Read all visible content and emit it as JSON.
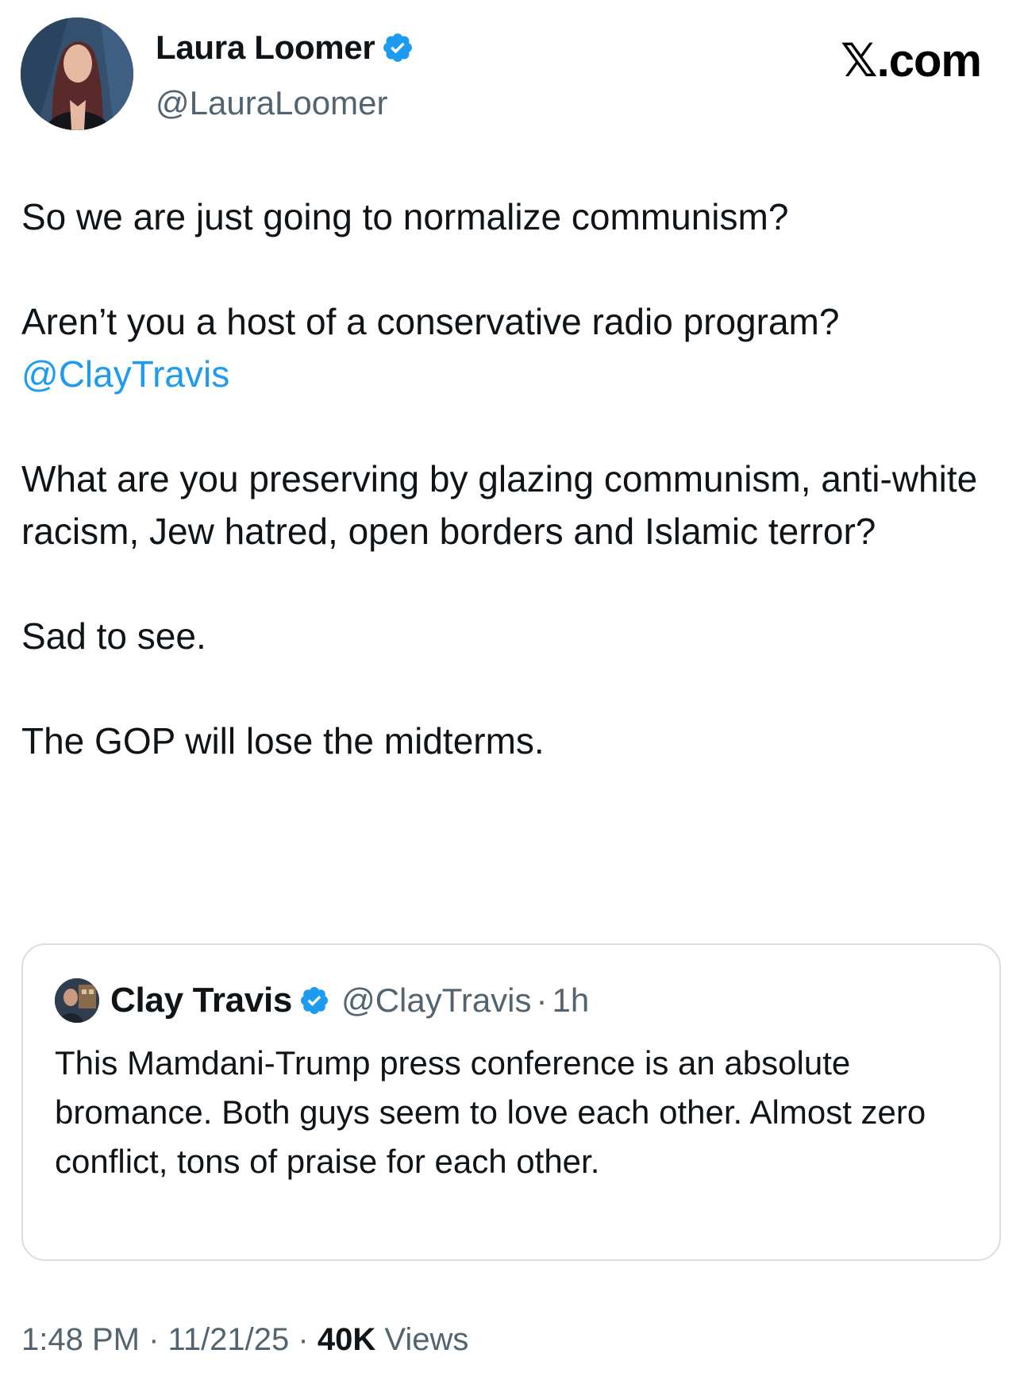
{
  "header": {
    "author_name": "Laura Loomer",
    "author_handle": "@LauraLoomer",
    "brand": "𝕏.com",
    "verified_color": "#1d9bf0"
  },
  "tweet": {
    "paragraphs": [
      "So we are just going to normalize communism?",
      "Aren’t you a host of a conservative radio program?",
      "What are you preserving by glazing communism, anti-white racism, Jew hatred, open borders and Islamic terror?",
      "Sad to see.",
      "The GOP will lose the midterms."
    ],
    "mention": "@ClayTravis",
    "mention_color": "#1d9bf0"
  },
  "quote": {
    "author_name": "Clay Travis",
    "author_handle": "@ClayTravis",
    "separator": "·",
    "time_ago": "1h",
    "text": "This Mamdani-Trump press conference is an absolute bromance. Both guys seem to love each other. Almost zero conflict, tons of praise for each other."
  },
  "footer": {
    "time": "1:48 PM",
    "separator": "·",
    "date": "11/21/25",
    "views_count": "40K",
    "views_label": "Views"
  }
}
